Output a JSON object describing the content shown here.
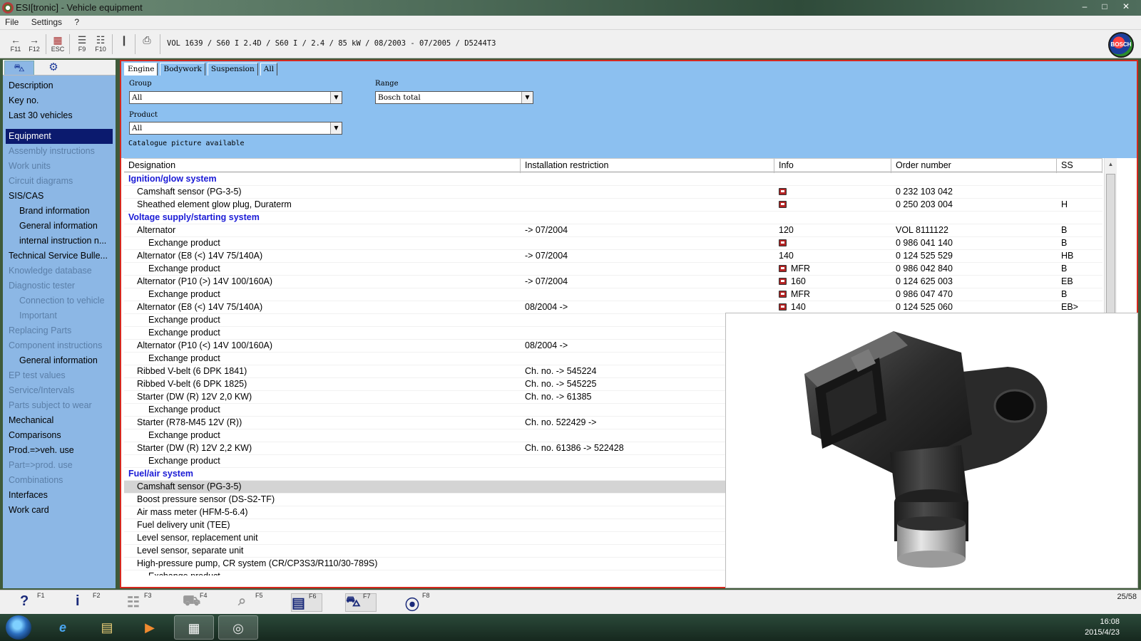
{
  "window": {
    "title": "ESI[tronic] - Vehicle equipment",
    "controls": [
      "–",
      "□",
      "✕"
    ]
  },
  "menu": [
    "File",
    "Settings",
    "?"
  ],
  "toolbar": {
    "buttons": [
      {
        "icon": "back-arrow-icon",
        "glyph": "←",
        "key": "F11"
      },
      {
        "icon": "forward-arrow-icon",
        "glyph": "→",
        "key": "F12"
      },
      {
        "icon": "escape-icon",
        "glyph": "▦",
        "key": "ESC"
      },
      {
        "icon": "document-list-icon",
        "glyph": "☰",
        "key": "F9"
      },
      {
        "icon": "document-split-icon",
        "glyph": "☷",
        "key": "F10"
      },
      {
        "icon": "page-icon",
        "glyph": "❙",
        "key": ""
      },
      {
        "icon": "printer-icon",
        "glyph": "⎙",
        "key": ""
      }
    ],
    "vehicle": "VOL 1639 / S60 I 2.4D / S60 I / 2.4 / 85 kW / 08/2003 - 07/2005 / D5244T3",
    "logo_text": "BOSCH"
  },
  "sidebar": {
    "tabs": [
      {
        "icon": "car-icon",
        "glyph": "⛍"
      },
      {
        "icon": "engine-icon",
        "glyph": "⚙"
      }
    ],
    "items": [
      {
        "label": "Description",
        "state": "normal",
        "level": 0
      },
      {
        "label": "Key no.",
        "state": "normal",
        "level": 0
      },
      {
        "label": "Last 30 vehicles",
        "state": "normal",
        "level": 0
      },
      {
        "label": "",
        "state": "spacer",
        "level": 0
      },
      {
        "label": "Equipment",
        "state": "selected",
        "level": 0
      },
      {
        "label": "Assembly instructions",
        "state": "disabled",
        "level": 0
      },
      {
        "label": "Work units",
        "state": "disabled",
        "level": 0
      },
      {
        "label": "Circuit diagrams",
        "state": "disabled",
        "level": 0
      },
      {
        "label": "SIS/CAS",
        "state": "normal",
        "level": 0
      },
      {
        "label": "Brand information",
        "state": "normal",
        "level": 1
      },
      {
        "label": "General information",
        "state": "normal",
        "level": 1
      },
      {
        "label": "internal instruction n...",
        "state": "normal",
        "level": 1
      },
      {
        "label": "Technical Service Bulle...",
        "state": "normal",
        "level": 0
      },
      {
        "label": "Knowledge database",
        "state": "disabled",
        "level": 0
      },
      {
        "label": "Diagnostic tester",
        "state": "disabled",
        "level": 0
      },
      {
        "label": "Connection to vehicle",
        "state": "disabled",
        "level": 1
      },
      {
        "label": "Important",
        "state": "disabled",
        "level": 1
      },
      {
        "label": "Replacing Parts",
        "state": "disabled",
        "level": 0
      },
      {
        "label": "Component instructions",
        "state": "disabled",
        "level": 0
      },
      {
        "label": "General information",
        "state": "normal",
        "level": 1
      },
      {
        "label": "EP test values",
        "state": "disabled",
        "level": 0
      },
      {
        "label": "Service/Intervals",
        "state": "disabled",
        "level": 0
      },
      {
        "label": "Parts subject to wear",
        "state": "disabled",
        "level": 0
      },
      {
        "label": "Mechanical",
        "state": "normal",
        "level": 0
      },
      {
        "label": "Comparisons",
        "state": "normal",
        "level": 0
      },
      {
        "label": "Prod.=>veh. use",
        "state": "normal",
        "level": 0
      },
      {
        "label": "Part=>prod. use",
        "state": "disabled",
        "level": 0
      },
      {
        "label": "Combinations",
        "state": "disabled",
        "level": 0
      },
      {
        "label": "Interfaces",
        "state": "normal",
        "level": 0
      },
      {
        "label": "Work card",
        "state": "normal",
        "level": 0
      }
    ]
  },
  "filters": {
    "tabs": [
      "Engine",
      "Bodywork",
      "Suspension",
      "All"
    ],
    "active_tab": "Engine",
    "group_label": "Group",
    "group_value": "All",
    "range_label": "Range",
    "range_value": "Bosch total",
    "product_label": "Product",
    "product_value": "All",
    "catalogue_note": "Catalogue picture available"
  },
  "table": {
    "columns": [
      "Designation",
      "Installation restriction",
      "Info",
      "Order number",
      "SS"
    ],
    "rows": [
      {
        "type": "group",
        "designation": "Ignition/glow system",
        "restriction": "",
        "cat": false,
        "info": "",
        "order": "",
        "ss": ""
      },
      {
        "type": "l1",
        "designation": "Camshaft sensor (PG-3-5)",
        "restriction": "",
        "cat": true,
        "info": "",
        "order": "0 232 103 042",
        "ss": ""
      },
      {
        "type": "l1",
        "designation": "Sheathed element glow plug, Duraterm",
        "restriction": "",
        "cat": true,
        "info": "",
        "order": "0 250 203 004",
        "ss": "H"
      },
      {
        "type": "group",
        "designation": "Voltage supply/starting system",
        "restriction": "",
        "cat": false,
        "info": "",
        "order": "",
        "ss": ""
      },
      {
        "type": "l1",
        "designation": "Alternator",
        "restriction": "-> 07/2004",
        "cat": false,
        "info": "120",
        "order": "VOL 8111122",
        "ss": "B"
      },
      {
        "type": "l2",
        "designation": "Exchange product",
        "restriction": "",
        "cat": true,
        "info": "",
        "order": "0 986 041 140",
        "ss": "B"
      },
      {
        "type": "l1",
        "designation": "Alternator (E8 (<) 14V 75/140A)",
        "restriction": "-> 07/2004",
        "cat": false,
        "info": "140",
        "order": "0 124 525 529",
        "ss": "HB"
      },
      {
        "type": "l2",
        "designation": "Exchange product",
        "restriction": "",
        "cat": true,
        "info": "MFR",
        "order": "0 986 042 840",
        "ss": "B"
      },
      {
        "type": "l1",
        "designation": "Alternator (P10 (>) 14V 100/160A)",
        "restriction": "-> 07/2004",
        "cat": true,
        "info": "160",
        "order": "0 124 625 003",
        "ss": "EB"
      },
      {
        "type": "l2",
        "designation": "Exchange product",
        "restriction": "",
        "cat": true,
        "info": "MFR",
        "order": "0 986 047 470",
        "ss": "B"
      },
      {
        "type": "l1",
        "designation": "Alternator (E8 (<) 14V 75/140A)",
        "restriction": "08/2004 ->",
        "cat": true,
        "info": "140",
        "order": "0 124 525 060",
        "ss": "EB>"
      },
      {
        "type": "l2",
        "designation": "Exchange product",
        "restriction": "",
        "cat": false,
        "info": "",
        "order": "",
        "ss": ""
      },
      {
        "type": "l2",
        "designation": "Exchange product",
        "restriction": "",
        "cat": false,
        "info": "",
        "order": "",
        "ss": ""
      },
      {
        "type": "l1",
        "designation": "Alternator (P10 (<) 14V 100/160A)",
        "restriction": "08/2004 ->",
        "cat": false,
        "info": "",
        "order": "",
        "ss": ""
      },
      {
        "type": "l2",
        "designation": "Exchange product",
        "restriction": "",
        "cat": false,
        "info": "",
        "order": "",
        "ss": ""
      },
      {
        "type": "l1",
        "designation": "Ribbed V-belt (6 DPK 1841)",
        "restriction": "Ch. no. -> 545224",
        "cat": false,
        "info": "",
        "order": "",
        "ss": ""
      },
      {
        "type": "l1",
        "designation": "Ribbed V-belt (6 DPK 1825)",
        "restriction": "Ch. no. -> 545225",
        "cat": false,
        "info": "",
        "order": "",
        "ss": ""
      },
      {
        "type": "l1",
        "designation": "Starter (DW (R) 12V 2,0 KW)",
        "restriction": "Ch. no. -> 61385",
        "cat": false,
        "info": "",
        "order": "",
        "ss": ""
      },
      {
        "type": "l2",
        "designation": "Exchange product",
        "restriction": "",
        "cat": false,
        "info": "",
        "order": "",
        "ss": ""
      },
      {
        "type": "l1",
        "designation": "Starter (R78-M45 12V (R))",
        "restriction": "Ch. no. 522429 ->",
        "cat": false,
        "info": "",
        "order": "",
        "ss": ""
      },
      {
        "type": "l2",
        "designation": "Exchange product",
        "restriction": "",
        "cat": false,
        "info": "",
        "order": "",
        "ss": ""
      },
      {
        "type": "l1",
        "designation": "Starter (DW (R) 12V 2,2 KW)",
        "restriction": "Ch. no. 61386 -> 522428",
        "cat": false,
        "info": "",
        "order": "",
        "ss": ""
      },
      {
        "type": "l2",
        "designation": "Exchange product",
        "restriction": "",
        "cat": false,
        "info": "",
        "order": "",
        "ss": ""
      },
      {
        "type": "group",
        "designation": "Fuel/air system",
        "restriction": "",
        "cat": false,
        "info": "",
        "order": "",
        "ss": ""
      },
      {
        "type": "l1 selected",
        "designation": "Camshaft sensor (PG-3-5)",
        "restriction": "",
        "cat": false,
        "info": "",
        "order": "",
        "ss": ""
      },
      {
        "type": "l1",
        "designation": "Boost pressure sensor (DS-S2-TF)",
        "restriction": "",
        "cat": false,
        "info": "",
        "order": "",
        "ss": ""
      },
      {
        "type": "l1",
        "designation": "Air mass meter (HFM-5-6.4)",
        "restriction": "",
        "cat": false,
        "info": "",
        "order": "",
        "ss": ""
      },
      {
        "type": "l1",
        "designation": "Fuel delivery unit (TEE)",
        "restriction": "",
        "cat": false,
        "info": "",
        "order": "",
        "ss": ""
      },
      {
        "type": "l1",
        "designation": "Level sensor, replacement unit",
        "restriction": "",
        "cat": false,
        "info": "",
        "order": "",
        "ss": ""
      },
      {
        "type": "l1",
        "designation": "Level sensor, separate unit",
        "restriction": "",
        "cat": false,
        "info": "",
        "order": "",
        "ss": ""
      },
      {
        "type": "l1",
        "designation": "High-pressure pump, CR system (CR/CP3S3/R110/30-789S)",
        "restriction": "",
        "cat": false,
        "info": "",
        "order": "",
        "ss": ""
      },
      {
        "type": "l2",
        "designation": "Exchange product",
        "restriction": "",
        "cat": false,
        "info": "",
        "order": "",
        "ss": ""
      }
    ]
  },
  "picture": {
    "subject": "camshaft-sensor-photo"
  },
  "function_bar": {
    "keys": [
      {
        "glyph": "?",
        "num": "F1",
        "icon": "help-icon",
        "dim": false,
        "pressed": false
      },
      {
        "glyph": "i",
        "num": "F2",
        "icon": "info-icon",
        "dim": false,
        "pressed": false
      },
      {
        "glyph": "☷",
        "num": "F3",
        "icon": "list-icon",
        "dim": true,
        "pressed": false
      },
      {
        "glyph": "⛟",
        "num": "F4",
        "icon": "cart-icon",
        "dim": true,
        "pressed": false
      },
      {
        "glyph": "⌕",
        "num": "F5",
        "icon": "zoom-icon",
        "dim": true,
        "pressed": false
      },
      {
        "glyph": "▤",
        "num": "F6",
        "icon": "catalogue-icon",
        "dim": false,
        "pressed": true
      },
      {
        "glyph": "⛍",
        "num": "F7",
        "icon": "vehicle-icon",
        "dim": false,
        "pressed": true
      },
      {
        "glyph": "⦿",
        "num": "F8",
        "icon": "bosch-icon",
        "dim": false,
        "pressed": false
      }
    ],
    "page_count": "25/58"
  },
  "taskbar": {
    "apps": [
      {
        "icon": "internet-explorer-icon",
        "glyph": "e"
      },
      {
        "icon": "file-explorer-icon",
        "glyph": "▤"
      },
      {
        "icon": "media-player-icon",
        "glyph": "▶"
      },
      {
        "icon": "esi-window-icon",
        "glyph": "▦"
      },
      {
        "icon": "esi-tronic-icon",
        "glyph": "◎"
      }
    ],
    "time": "16:08",
    "date": "2015/4/23"
  }
}
